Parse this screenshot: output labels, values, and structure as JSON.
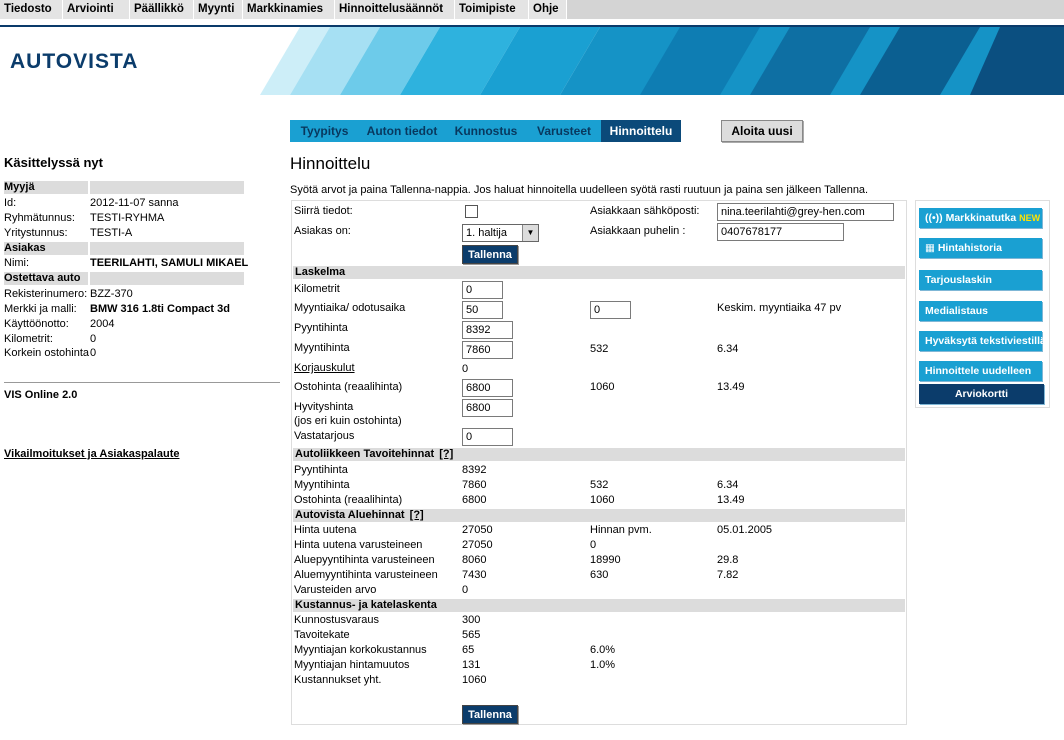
{
  "menu": [
    "Tiedosto",
    "Arviointi",
    "Päällikkö",
    "Myynti",
    "Markkinamies",
    "Hinnoittelusäännöt",
    "Toimipiste",
    "Ohje"
  ],
  "brand": "AUTOVISTA",
  "left": {
    "heading": "Käsittelyssä nyt",
    "myyja": {
      "title": "Myyjä",
      "id_label": "Id:",
      "id_value": "2012-11-07  sanna",
      "group_label": "Ryhmätunnus:",
      "group_value": "TESTI-RYHMA",
      "company_label": "Yritystunnus:",
      "company_value": "TESTI-A"
    },
    "asiakas": {
      "title": "Asiakas",
      "name_label": "Nimi:",
      "name_value": "TEERILAHTI, SAMULI MIKAEL"
    },
    "auto": {
      "title": "Ostettava auto",
      "reg_label": "Rekisterinumero:",
      "reg_value": "BZZ-370",
      "model_label": "Merkki ja malli:",
      "model_value": "BMW 316 1.8ti Compact 3d",
      "year_label": "Käyttöönotto:",
      "year_value": "2004",
      "km_label": "Kilometrit:",
      "km_value": "0",
      "max_label": "Korkein ostohinta",
      "max_value": "0"
    },
    "version": "VIS Online 2.0",
    "feedback_link": "Vikailmoitukset ja Asiakaspalaute"
  },
  "tabs": [
    "Tyypitys",
    "Auton tiedot",
    "Kunnostus",
    "Varusteet",
    "Hinnoittelu"
  ],
  "aloita_label": "Aloita uusi",
  "page_title": "Hinnoittelu",
  "instruction": "Syötä arvot ja paina Tallenna-nappia. Jos haluat hinnoitella uudelleen syötä rasti ruutuun ja paina sen jälkeen Tallenna.",
  "form": {
    "siirra_label": "Siirrä tiedot:",
    "asiakas_on_label": "Asiakas on:",
    "asiakas_on_value": "1. haltija",
    "email_label": "Asiakkaan sähköposti:",
    "email_value": "nina.teerilahti@grey-hen.com",
    "phone_label": "Asiakkaan puhelin :",
    "phone_value": "0407678177",
    "save_label": "Tallenna"
  },
  "laskelma": {
    "title": "Laskelma",
    "kilometrit_label": "Kilometrit",
    "kilometrit_value": "0",
    "myyntiaika_label": "Myyntiaika/ odotusaika",
    "myyntiaika_value": "50",
    "odotusaika_value": "0",
    "keskim": "Keskim. myyntiaika 47 pv",
    "pyyntihinta_label": "Pyyntihinta",
    "pyyntihinta_value": "8392",
    "myyntihinta_label": "Myyntihinta",
    "myyntihinta_value": "7860",
    "myyntihinta_diff": "532",
    "myyntihinta_pct": "6.34",
    "korjauskulut_label": "Korjauskulut",
    "korjauskulut_value": "0",
    "ostohinta_label": "Ostohinta (reaalihinta)",
    "ostohinta_value": "6800",
    "ostohinta_diff": "1060",
    "ostohinta_pct": "13.49",
    "hyvitys_label1": "Hyvityshinta",
    "hyvitys_label2": "(jos eri kuin ostohinta)",
    "hyvitys_value": "6800",
    "vastatarjous_label": "Vastatarjous",
    "vastatarjous_value": "0"
  },
  "tavoite": {
    "title": "Autoliikkeen Tavoitehinnat",
    "help": "[?]",
    "pyynti_label": "Pyyntihinta",
    "pyynti_value": "8392",
    "myynti_label": "Myyntihinta",
    "myynti_value": "7860",
    "myynti_diff": "532",
    "myynti_pct": "6.34",
    "osto_label": "Ostohinta (reaalihinta)",
    "osto_value": "6800",
    "osto_diff": "1060",
    "osto_pct": "13.49"
  },
  "alue": {
    "title": "Autovista Aluehinnat",
    "help": "[?]",
    "uutena_label": "Hinta uutena",
    "uutena_value": "27050",
    "pvm_label": "Hinnan pvm.",
    "pvm_value": "05.01.2005",
    "uutena_var_label": "Hinta uutena varusteineen",
    "uutena_var_value": "27050",
    "uutena_var_extra": "0",
    "aluepyynti_label": "Aluepyyntihinta varusteineen",
    "aluepyynti_value": "8060",
    "aluepyynti_b": "18990",
    "aluepyynti_c": "29.8",
    "aluemyynti_label": "Aluemyyntihinta varusteineen",
    "aluemyynti_value": "7430",
    "aluemyynti_b": "630",
    "aluemyynti_c": "7.82",
    "varusteet_label": "Varusteiden arvo",
    "varusteet_value": "0"
  },
  "kustannus": {
    "title": "Kustannus- ja katelaskenta",
    "kunnostus_label": "Kunnostusvaraus",
    "kunnostus_value": "300",
    "tavoitekate_label": "Tavoitekate",
    "tavoitekate_value": "565",
    "korko_label": "Myyntiajan korkokustannus",
    "korko_value": "65",
    "korko_pct": "6.0%",
    "hintamuutos_label": "Myyntiajan hintamuutos",
    "hintamuutos_value": "131",
    "hintamuutos_pct": "1.0%",
    "yht_label": "Kustannukset yht.",
    "yht_value": "1060"
  },
  "tools": {
    "markkinatutka": "Markkinatutka",
    "new_badge": "NEW",
    "hintahistoria": "Hintahistoria",
    "tarjouslaskin": "Tarjouslaskin",
    "medialistaus": "Medialistaus",
    "hyvaksyta": "Hyväksytä tekstiviestillä",
    "hinnoittele": "Hinnoittele uudelleen",
    "arviokortti": "Arviokortti"
  },
  "colors": {
    "accent": "#1aa0d2",
    "dark": "#0b3c6b",
    "section": "#dcdcdc"
  }
}
